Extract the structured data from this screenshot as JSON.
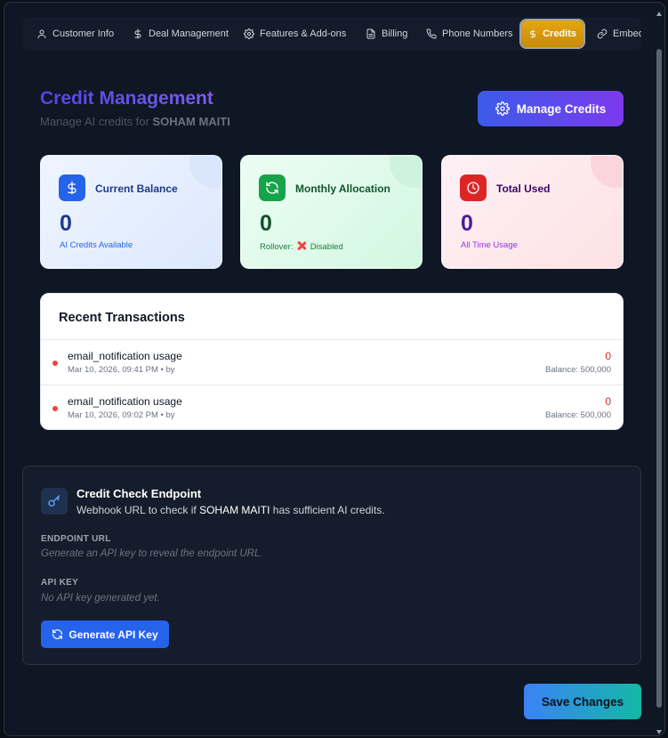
{
  "tabs": [
    {
      "label": "Customer Info",
      "icon": "user-icon"
    },
    {
      "label": "Deal Management",
      "icon": "dollar-icon"
    },
    {
      "label": "Features & Add-ons",
      "icon": "gear-icon"
    },
    {
      "label": "Billing",
      "icon": "document-icon"
    },
    {
      "label": "Phone Numbers",
      "icon": "phone-icon"
    },
    {
      "label": "Credits",
      "icon": "dollar-icon",
      "active": true
    },
    {
      "label": "Embed",
      "icon": "link-icon"
    }
  ],
  "header": {
    "title": "Credit Management",
    "subtitle_prefix": "Manage AI credits for",
    "customer_name": "SOHAM MAITI",
    "manage_button": "Manage Credits"
  },
  "cards": {
    "balance": {
      "label": "Current Balance",
      "value": "0",
      "sub": "AI Credits Available",
      "icon": "dollar-icon"
    },
    "monthly": {
      "label": "Monthly Allocation",
      "value": "0",
      "sub_prefix": "Rollover:",
      "sub_status": "Disabled",
      "icon": "refresh-icon"
    },
    "used": {
      "label": "Total Used",
      "value": "0",
      "sub": "All Time Usage",
      "icon": "clock-icon"
    }
  },
  "transactions": {
    "title": "Recent Transactions",
    "rows": [
      {
        "description": "email_notification usage",
        "meta": "Mar 10, 2026, 09:41 PM • by",
        "amount": "0",
        "balance": "Balance: 500,000"
      },
      {
        "description": "email_notification usage",
        "meta": "Mar 10, 2026, 09:02 PM • by",
        "amount": "0",
        "balance": "Balance: 500,000"
      }
    ]
  },
  "endpoint": {
    "title": "Credit Check Endpoint",
    "desc_prefix": "Webhook URL to check if",
    "desc_name": "SOHAM MAITI",
    "desc_suffix": "has sufficient AI credits.",
    "url_label": "ENDPOINT URL",
    "url_value": "Generate an API key to reveal the endpoint URL.",
    "key_label": "API KEY",
    "key_value": "No API key generated yet.",
    "generate_button": "Generate API Key"
  },
  "footer": {
    "save_button": "Save Changes"
  },
  "colors": {
    "accent_blue": "#2563eb",
    "credits_tab": "#d99a0b",
    "negative": "#dc2626"
  }
}
